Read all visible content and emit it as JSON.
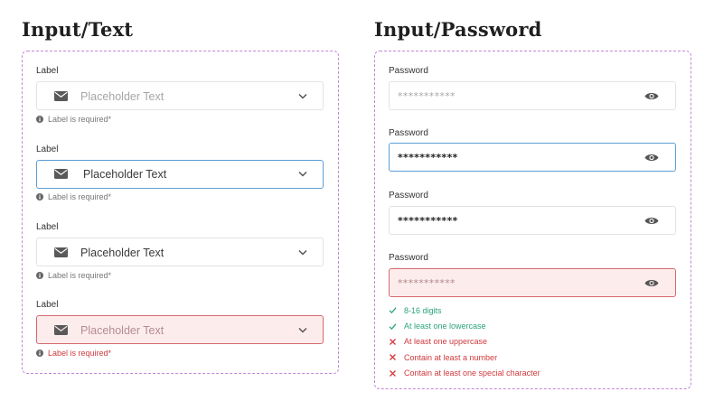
{
  "text_section": {
    "title": "Input/Text",
    "fields": [
      {
        "state": "default",
        "label": "Label",
        "text": "Placeholder Text",
        "text_style": "placeholder",
        "helper": "Label is required*",
        "helper_style": "normal"
      },
      {
        "state": "focus",
        "label": "Label",
        "text": "Placeholder Text",
        "text_style": "value",
        "helper": "Label is required*",
        "helper_style": "normal"
      },
      {
        "state": "filled",
        "label": "Label",
        "text": "Placeholder Text",
        "text_style": "value",
        "helper": "Label is required*",
        "helper_style": "normal"
      },
      {
        "state": "error",
        "label": "Label",
        "text": "Placeholder Text",
        "text_style": "placeholder",
        "helper": "Label is required*",
        "helper_style": "error"
      }
    ]
  },
  "password_section": {
    "title": "Input/Password",
    "fields": [
      {
        "state": "default",
        "label": "Password",
        "text": "***********",
        "text_style": "placeholder"
      },
      {
        "state": "focus",
        "label": "Password",
        "text": "***********",
        "text_style": "value"
      },
      {
        "state": "filled",
        "label": "Password",
        "text": "***********",
        "text_style": "value"
      },
      {
        "state": "error",
        "label": "Password",
        "text": "***********",
        "text_style": "placeholder"
      }
    ],
    "rules": [
      {
        "text": "8-16 digits",
        "status": "pass"
      },
      {
        "text": "At least one lowercase",
        "status": "pass"
      },
      {
        "text": "At least one uppercase",
        "status": "fail"
      },
      {
        "text": "Contain at least a number",
        "status": "fail"
      },
      {
        "text": "Contain at least one special character",
        "status": "fail"
      }
    ]
  },
  "icons": {
    "field_icon": "envelope-icon",
    "dropdown_icon": "chevron-down-icon",
    "helper_icon": "info-icon",
    "password_toggle_icon": "eye-icon",
    "rule_pass_icon": "check-icon",
    "rule_fail_icon": "x-icon"
  },
  "colors": {
    "panel_border": "#c287d8",
    "focus_border": "#5b9fd6",
    "error_border": "#d56a6e",
    "error_fill": "#fdecec",
    "error_text": "#d0393d",
    "success_text": "#2aa578"
  }
}
